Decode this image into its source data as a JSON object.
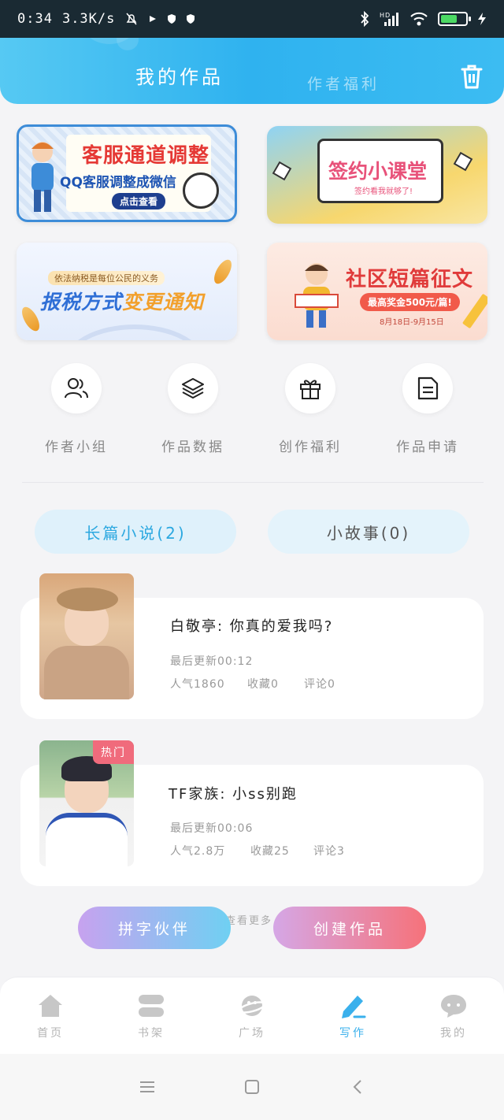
{
  "status_bar": {
    "time": "0:34",
    "speed": "3.3K/s",
    "network": "HD"
  },
  "header": {
    "tab_active": "我的作品",
    "tab_inactive": "作者福利"
  },
  "banners": {
    "b1_title": "客服通道调整",
    "b1_sub": "QQ客服调整成微信",
    "b1_btn": "点击查看",
    "b2_title": "签约小课堂",
    "b2_sub": "签约看我就够了!",
    "b3_tag": "依法纳税是每位公民的义务",
    "b3_title_a": "报税方式",
    "b3_title_b": "变更通知",
    "b4_title": "社区短篇征文",
    "b4_pill": "最高奖金500元/篇!",
    "b4_date": "8月18日-9月15日"
  },
  "actions": [
    {
      "label": "作者小组",
      "icon": "users-icon"
    },
    {
      "label": "作品数据",
      "icon": "layers-icon"
    },
    {
      "label": "创作福利",
      "icon": "gift-icon"
    },
    {
      "label": "作品申请",
      "icon": "document-icon"
    }
  ],
  "categories": {
    "novel": "长篇小说(2)",
    "story": "小故事(0)"
  },
  "works": [
    {
      "title": "白敬亭: 你真的爱我吗?",
      "updated": "最后更新00:12",
      "popularity": "人气1860",
      "favorites": "收藏0",
      "comments": "评论0"
    },
    {
      "title": "TF家族: 小ss别跑",
      "updated": "最后更新00:06",
      "popularity": "人气2.8万",
      "favorites": "收藏25",
      "comments": "评论3",
      "badge": "热门"
    }
  ],
  "buttons": {
    "more": "查看更多",
    "partner": "拼字伙伴",
    "create": "创建作品"
  },
  "nav": [
    {
      "label": "首页",
      "icon": "home-icon"
    },
    {
      "label": "书架",
      "icon": "bookshelf-icon"
    },
    {
      "label": "广场",
      "icon": "planet-icon"
    },
    {
      "label": "写作",
      "icon": "pen-icon"
    },
    {
      "label": "我的",
      "icon": "chat-icon"
    }
  ],
  "colors": {
    "accent": "#2fb2ef",
    "active_nav": "#3ab0ec",
    "hot_badge": "#f06b7c"
  }
}
